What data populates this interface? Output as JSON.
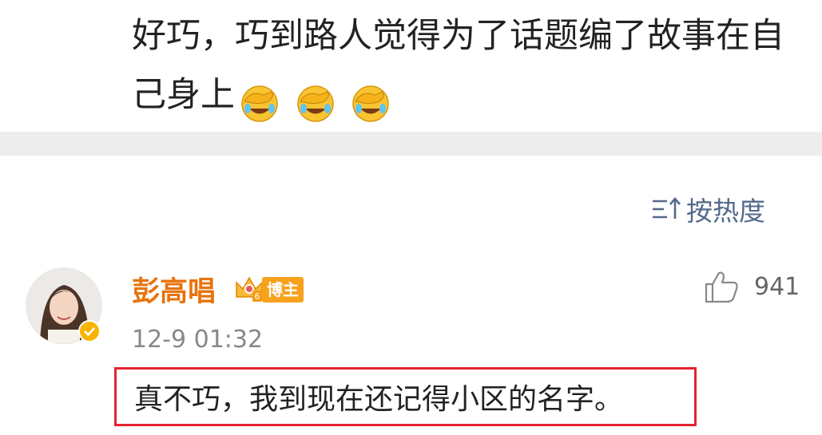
{
  "post": {
    "text": "好巧，巧到路人觉得为了话题编了故事在自己身上",
    "emojis": [
      "facepalm-laugh-emoji",
      "facepalm-laugh-emoji",
      "facepalm-laugh-emoji"
    ]
  },
  "sort": {
    "label": "按热度",
    "icon": "sort-icon"
  },
  "comment": {
    "username": "彭高唱",
    "badge": "博主",
    "crown_icon": "crown-icon",
    "verified_icon": "verified-icon",
    "time": "12-9 01:32",
    "like_icon": "thumbs-up-icon",
    "likes": "941",
    "text": "真不巧，我到现在还记得小区的名字。"
  },
  "colors": {
    "username": "#e8730d",
    "link": "#546a8a",
    "highlight_border": "#e4242f",
    "separator": "#ededed"
  }
}
